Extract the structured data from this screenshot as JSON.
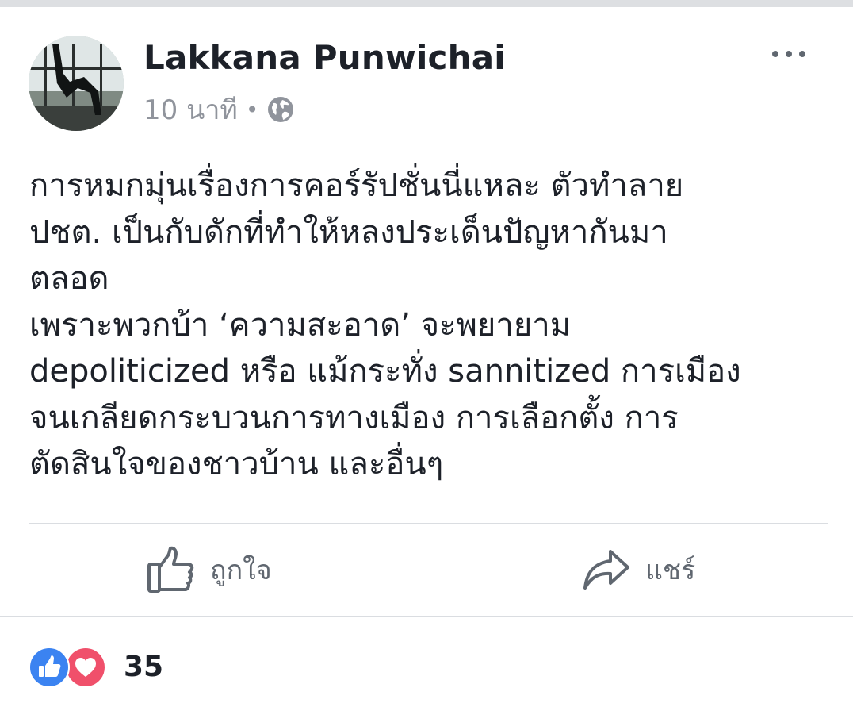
{
  "post": {
    "author": "Lakkana Punwichai",
    "timestamp": "10 นาที",
    "separator": "•",
    "privacy_icon": "globe-icon",
    "menu_icon": "more-options-icon",
    "text_lines": [
      "การหมกมุ่นเรื่องการคอร์รัปชั่นนี่แหละ ตัวทำลาย",
      "ปชต. เป็นกับดักที่ทำให้หลงประเด็นปัญหากันมา",
      "ตลอด",
      "เพราะพวกบ้า ‘ความสะอาด’ จะพยายาม",
      "depoliticized หรือ แม้กระทั่ง sannitized การเมือง",
      "จนเกลียดกระบวนการทางเมือง การเลือกตั้ง การ",
      "ตัดสินใจของชาวบ้าน และอื่นๆ"
    ]
  },
  "actions": {
    "like": {
      "label": "ถูกใจ",
      "icon": "thumbs-up-icon"
    },
    "share": {
      "label": "แชร์",
      "icon": "share-arrow-icon"
    }
  },
  "reactions": {
    "types": [
      "like",
      "love"
    ],
    "count": "35"
  },
  "colors": {
    "text": "#1d2129",
    "muted": "#90949c",
    "icon": "#606770",
    "like_blue": "#3b83f1",
    "love_red": "#f0506b",
    "divider": "#dadde1"
  }
}
